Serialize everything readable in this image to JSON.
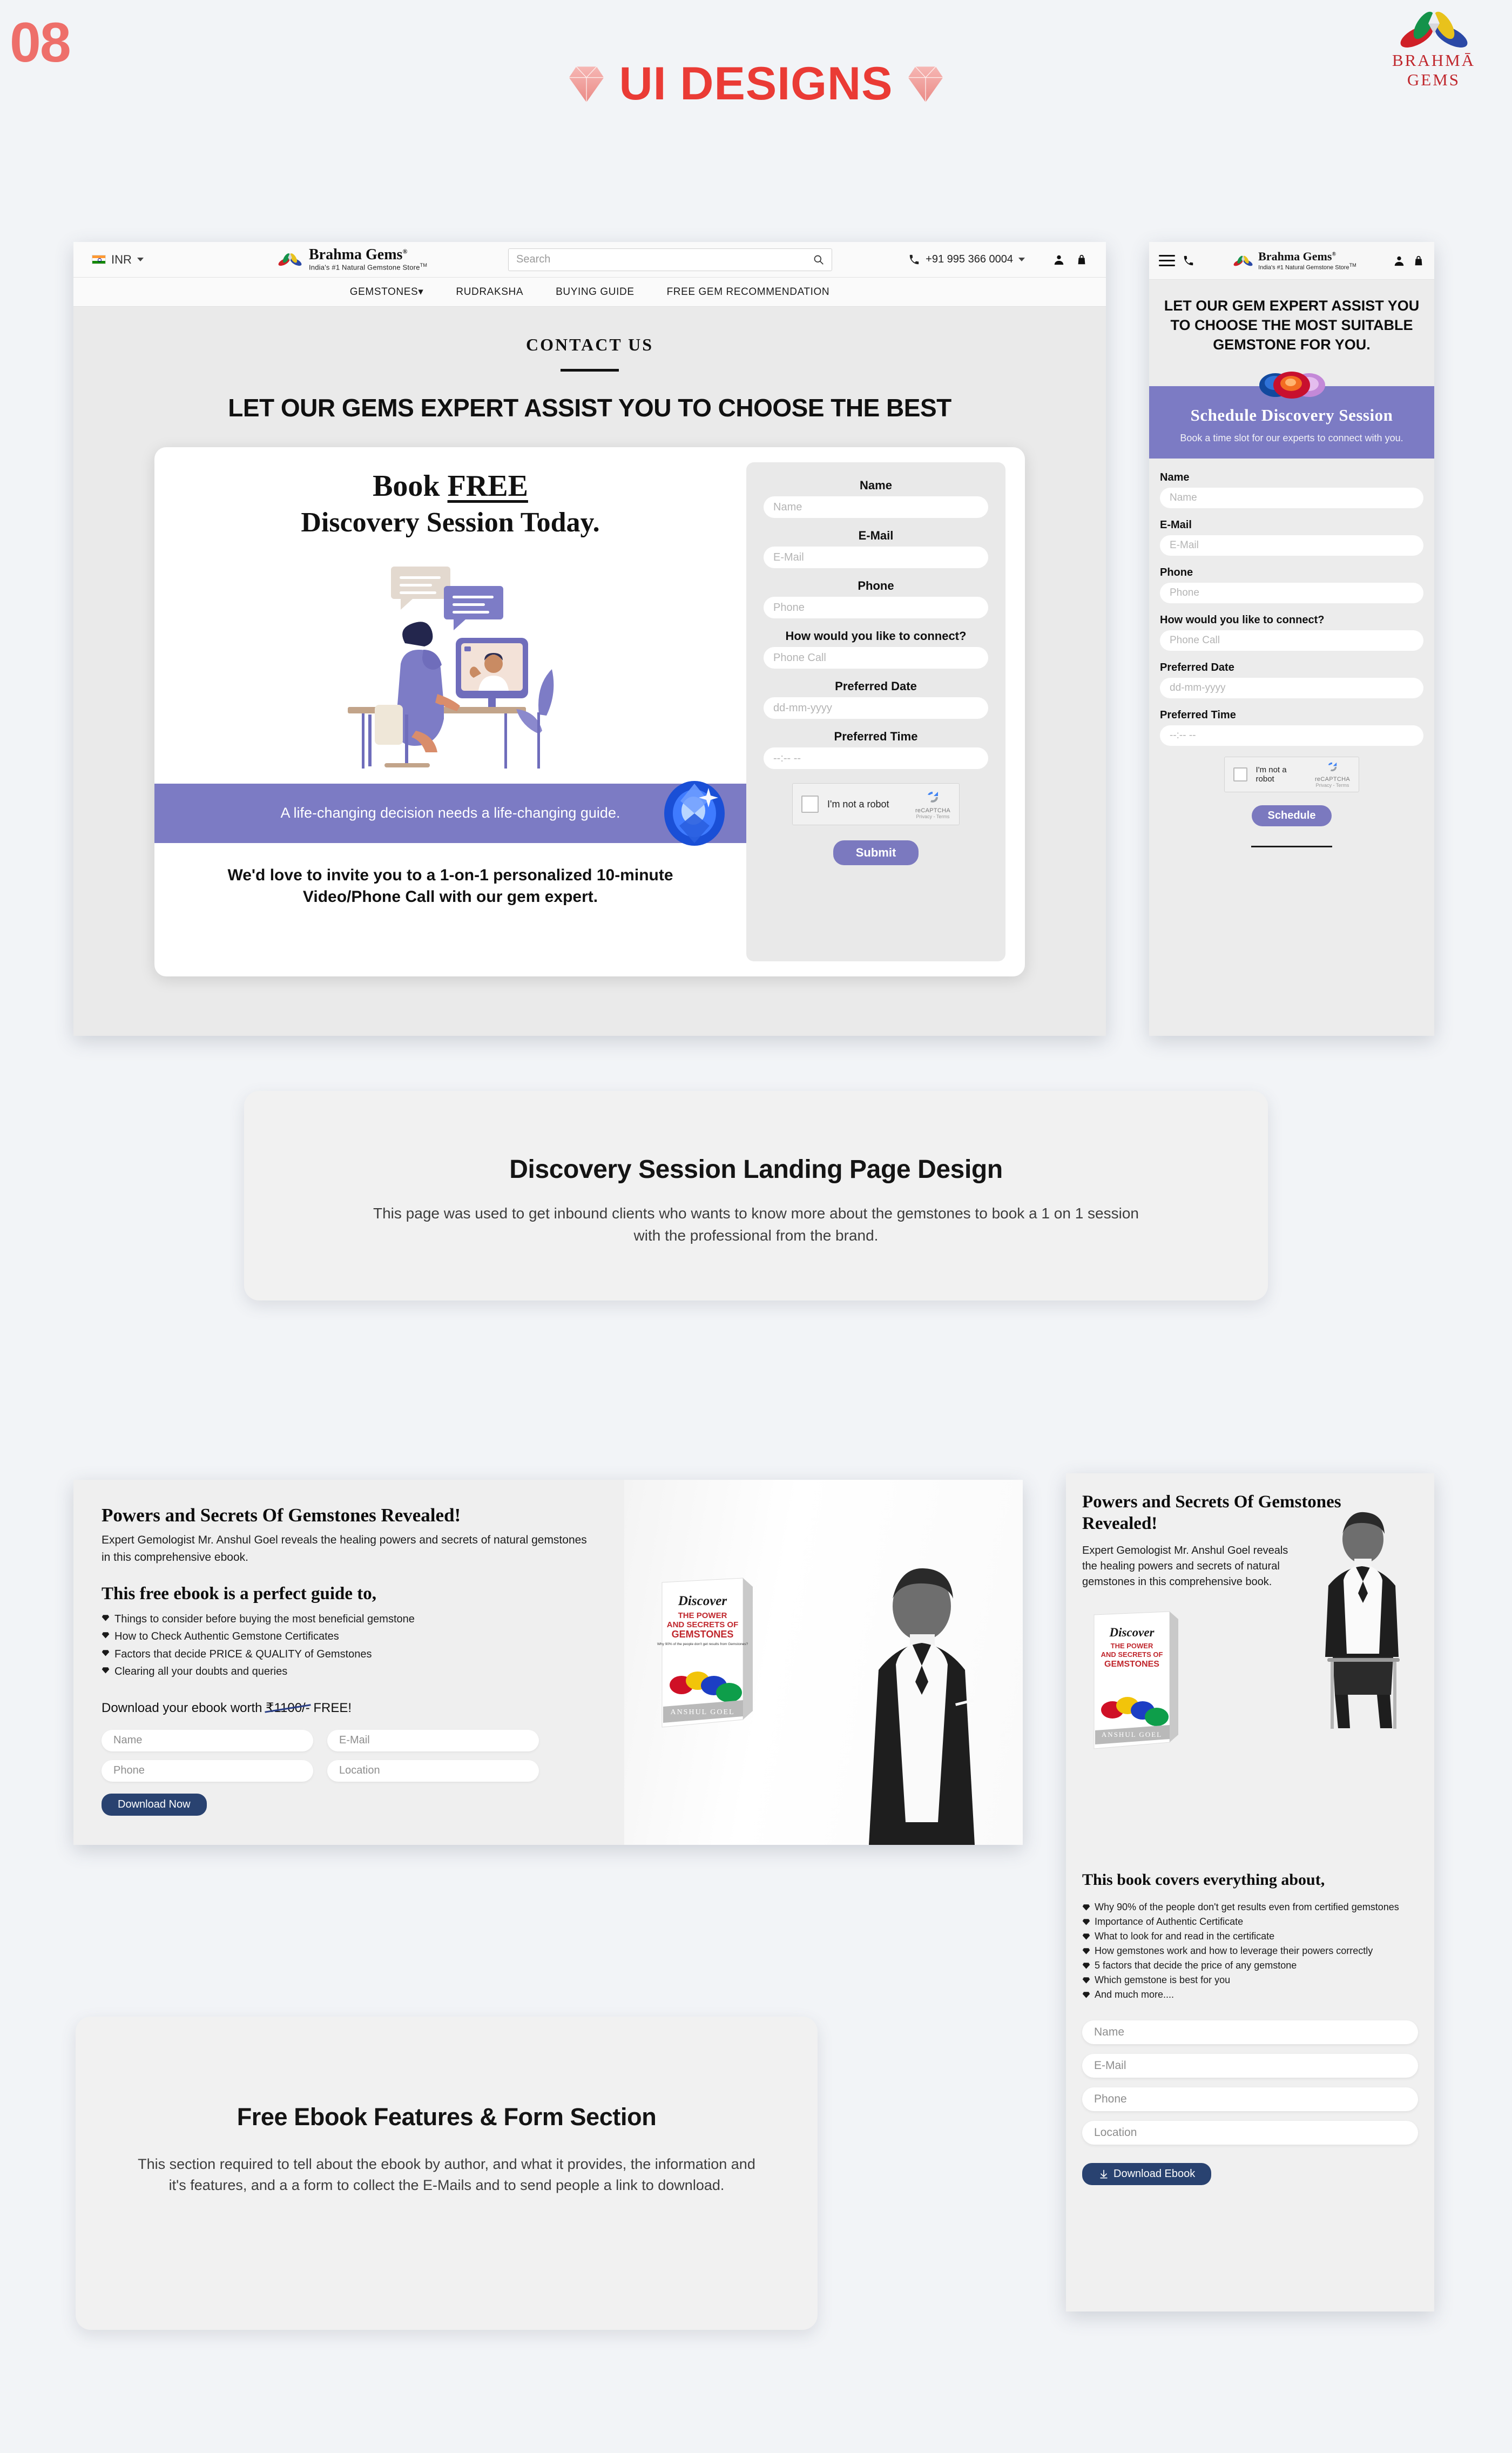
{
  "page": {
    "number": "08",
    "title": "UI DESIGNS",
    "brand_name": "BRAHMĀ GEMS",
    "accent_red": "#ea3b35",
    "accent_salmon": "#ee6f6a",
    "accent_purple": "#7c7bc4",
    "accent_navy": "#294270",
    "background": "#f2f4f7"
  },
  "desktop_discovery": {
    "topbar": {
      "currency": "INR",
      "logo_name": "Brahma Gems",
      "logo_reg": "®",
      "logo_tagline": "India's #1 Natural Gemstone Store",
      "logo_tm": "TM",
      "search_placeholder": "Search",
      "phone": "+91 995 366 0004"
    },
    "nav": [
      "GEMSTONES",
      "RUDRAKSHA",
      "BUYING GUIDE",
      "FREE GEM RECOMMENDATION"
    ],
    "nav_caret": "▾",
    "hero": {
      "kicker": "CONTACT US",
      "heading": "LET OUR GEMS EXPERT ASSIST YOU TO CHOOSE THE BEST",
      "title_line1_pre": "Book ",
      "title_line1_em": "FREE",
      "title_line2": "Discovery Session Today.",
      "band_text": "A life-changing decision needs a life-changing guide.",
      "footer_text": "We'd love to invite you to a 1-on-1 personalized 10-minute Video/Phone Call with our gem expert."
    },
    "form": {
      "fields": [
        {
          "label": "Name",
          "placeholder": "Name"
        },
        {
          "label": "E-Mail",
          "placeholder": "E-Mail"
        },
        {
          "label": "Phone",
          "placeholder": "Phone"
        },
        {
          "label": "How would you like to connect?",
          "placeholder": "Phone Call"
        },
        {
          "label": "Preferred Date",
          "placeholder": "dd-mm-yyyy"
        },
        {
          "label": "Preferred Time",
          "placeholder": "--:-- --"
        }
      ],
      "recaptcha_label": "I'm not a robot",
      "recaptcha_name": "reCAPTCHA",
      "recaptcha_links": "Privacy - Terms",
      "submit_label": "Submit"
    }
  },
  "mobile_discovery": {
    "topbar": {
      "logo_name": "Brahma Gems",
      "logo_reg": "®",
      "logo_tagline": "India's #1 Natural Gemstone Store",
      "logo_tm": "TM"
    },
    "heading": "LET OUR GEM EXPERT ASSIST YOU TO CHOOSE THE MOST SUITABLE GEMSTONE FOR YOU.",
    "banner_title": "Schedule Discovery Session",
    "banner_sub": "Book a time slot for our experts to connect with you.",
    "form": {
      "fields": [
        {
          "label": "Name",
          "placeholder": "Name"
        },
        {
          "label": "E-Mail",
          "placeholder": "E-Mail"
        },
        {
          "label": "Phone",
          "placeholder": "Phone"
        },
        {
          "label": "How would you like to connect?",
          "placeholder": "Phone Call"
        },
        {
          "label": "Preferred Date",
          "placeholder": "dd-mm-yyyy"
        },
        {
          "label": "Preferred Time",
          "placeholder": "--:-- --"
        }
      ],
      "recaptcha_label": "I'm not a robot",
      "recaptcha_name": "reCAPTCHA",
      "recaptcha_links": "Privacy - Terms",
      "submit_label": "Schedule"
    }
  },
  "caption_one": {
    "title": "Discovery Session Landing Page Design",
    "body": "This page was used to get inbound clients who wants to know more about the gemstones to book a 1 on 1 session with the professional from the brand."
  },
  "desktop_ebook": {
    "heading": "Powers and Secrets Of Gemstones Revealed!",
    "sub": "Expert Gemologist Mr. Anshul Goel reveals the healing powers and secrets of natural gemstones in this comprehensive ebook.",
    "list_heading": "This free ebook is a perfect guide to,",
    "list": [
      "Things to consider before buying the most beneficial gemstone",
      "How to Check Authentic Gemstone Certificates",
      "Factors that decide PRICE & QUALITY of Gemstones",
      "Clearing all your doubts and queries"
    ],
    "price_pre": "Download your ebook worth ",
    "price_struck": "₹1100/-",
    "price_post": " FREE!",
    "fields": [
      {
        "placeholder": "Name"
      },
      {
        "placeholder": "E-Mail"
      },
      {
        "placeholder": "Phone"
      },
      {
        "placeholder": "Location"
      }
    ],
    "button_label": "Download Now",
    "book_cover": {
      "script": "Discover",
      "line1": "THE POWER",
      "line2": "AND SECRETS OF",
      "line3": "GEMSTONES",
      "tagline": "Why 90% of the people don't get results from Gemstones?",
      "author": "ANSHUL GOEL"
    }
  },
  "mobile_ebook": {
    "heading": "Powers and Secrets Of Gemstones Revealed!",
    "sub": "Expert Gemologist Mr. Anshul Goel reveals the healing powers and secrets of natural gemstones in this comprehensive book.",
    "list_heading": "This book covers everything about,",
    "list": [
      "Why 90% of the people don't get results even from certified gemstones",
      "Importance of Authentic Certificate",
      "What to look for and read in the certificate",
      "How gemstones work and how to leverage their powers correctly",
      "5 factors that decide the price of any gemstone",
      "Which gemstone is best for you",
      "And much more...."
    ],
    "fields": [
      {
        "placeholder": "Name"
      },
      {
        "placeholder": "E-Mail"
      },
      {
        "placeholder": "Phone"
      },
      {
        "placeholder": "Location"
      }
    ],
    "button_label": "Download Ebook",
    "book_cover": {
      "script": "Discover",
      "line1": "THE POWER",
      "line2": "AND SECRETS OF",
      "line3": "GEMSTONES",
      "author": "ANSHUL GOEL"
    }
  },
  "caption_two": {
    "title": "Free Ebook Features & Form Section",
    "body": "This section required to tell about the ebook by author, and what it provides, the information and it's features, and a a form to collect the E-Mails and to send people a link to download."
  }
}
